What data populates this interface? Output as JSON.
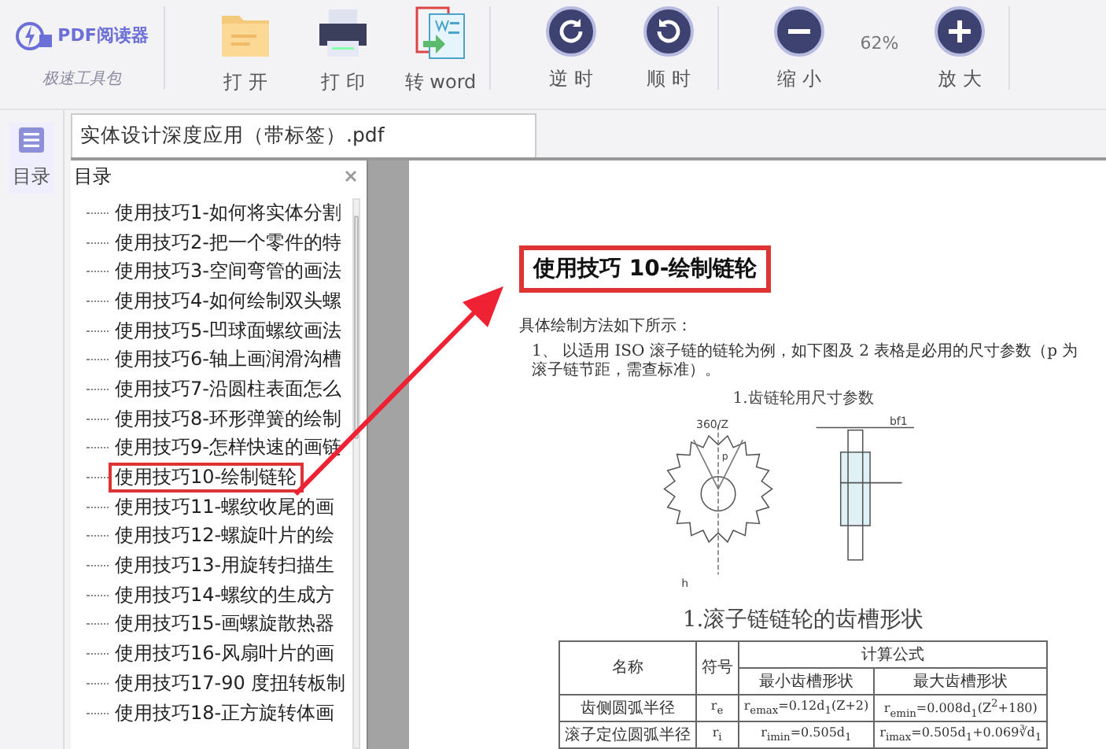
{
  "toolbar": {
    "logo": {
      "name": "PDF阅读器",
      "subtitle": "极速工具包"
    },
    "items": [
      {
        "kind": "open",
        "label": "打 开"
      },
      {
        "kind": "print",
        "label": "打 印"
      },
      {
        "kind": "word",
        "label": "转 word"
      },
      {
        "kind": "divider"
      },
      {
        "kind": "rotate_ccw",
        "label": "逆 时"
      },
      {
        "kind": "rotate_cw",
        "label": "顺 时"
      },
      {
        "kind": "divider"
      },
      {
        "kind": "zoom_out",
        "label": "缩 小"
      },
      {
        "kind": "readout",
        "label": "62%"
      },
      {
        "kind": "zoom_in",
        "label": "放 大"
      },
      {
        "kind": "divider"
      }
    ]
  },
  "sidebar": {
    "items": [
      {
        "label": "目录",
        "selected": true
      }
    ]
  },
  "tab": {
    "title": "实体设计深度应用（带标签）.pdf"
  },
  "outline": {
    "title": "目录",
    "items": [
      {
        "label": "使用技巧1-如何将实体分割",
        "highlighted": false
      },
      {
        "label": "使用技巧2-把一个零件的特",
        "highlighted": false
      },
      {
        "label": "使用技巧3-空间弯管的画法",
        "highlighted": false
      },
      {
        "label": "使用技巧4-如何绘制双头螺",
        "highlighted": false
      },
      {
        "label": "使用技巧5-凹球面螺纹画法",
        "highlighted": false
      },
      {
        "label": "使用技巧6-轴上画润滑沟槽",
        "highlighted": false
      },
      {
        "label": "使用技巧7-沿圆柱表面怎么",
        "highlighted": false
      },
      {
        "label": "使用技巧8-环形弹簧的绘制",
        "highlighted": false
      },
      {
        "label": "使用技巧9-怎样快速的画链",
        "highlighted": false
      },
      {
        "label": "使用技巧10-绘制链轮",
        "highlighted": true
      },
      {
        "label": "使用技巧11-螺纹收尾的画",
        "highlighted": false
      },
      {
        "label": "使用技巧12-螺旋叶片的绘",
        "highlighted": false
      },
      {
        "label": "使用技巧13-用旋转扫描生",
        "highlighted": false
      },
      {
        "label": "使用技巧14-螺纹的生成方",
        "highlighted": false
      },
      {
        "label": "使用技巧15-画螺旋散热器",
        "highlighted": false
      },
      {
        "label": "使用技巧16-风扇叶片的画",
        "highlighted": false
      },
      {
        "label": "使用技巧17-90 度扭转板制",
        "highlighted": false
      },
      {
        "label": "使用技巧18-正方旋转体画",
        "highlighted": false
      }
    ]
  },
  "page": {
    "title": "使用技巧 10-绘制链轮",
    "title_highlighted": true,
    "intro": "具体绘制方法如下所示：",
    "step": "1、 以适用 ISO 滚子链的链轮为例，如下图及 2 表格是必用的尺寸参数（p 为滚子链节距，需查标准）。",
    "figure_caption": "1.齿链轮用尺寸参数",
    "drawing_labels": [
      "360/Z",
      "p",
      "bf1",
      "h"
    ],
    "table_caption": "1.滚子链链轮的齿槽形状",
    "table": {
      "columns": [
        {
          "label": "名称",
          "rowspan": 2
        },
        {
          "label": "符号",
          "rowspan": 2
        },
        {
          "label": "计算公式",
          "colspan": 2
        }
      ],
      "rows": [
        [
          "最小齿槽形状",
          "最大齿槽形状"
        ],
        [
          "齿侧圆弧半径",
          "r$_{e}$",
          "r$_{emax}$=0.12d$_{1}$(Z+2)",
          "r$_{emin}$=0.008d$_{1}$(Z$^{2}$+180)"
        ],
        [
          "滚子定位圆弧半径",
          "r$_{i}$",
          "r$_{imin}$=0.505d$_{1}$",
          "r$_{imax}$=0.505d$_{1}$+0.069∛d$_{1}$"
        ]
      ]
    }
  }
}
